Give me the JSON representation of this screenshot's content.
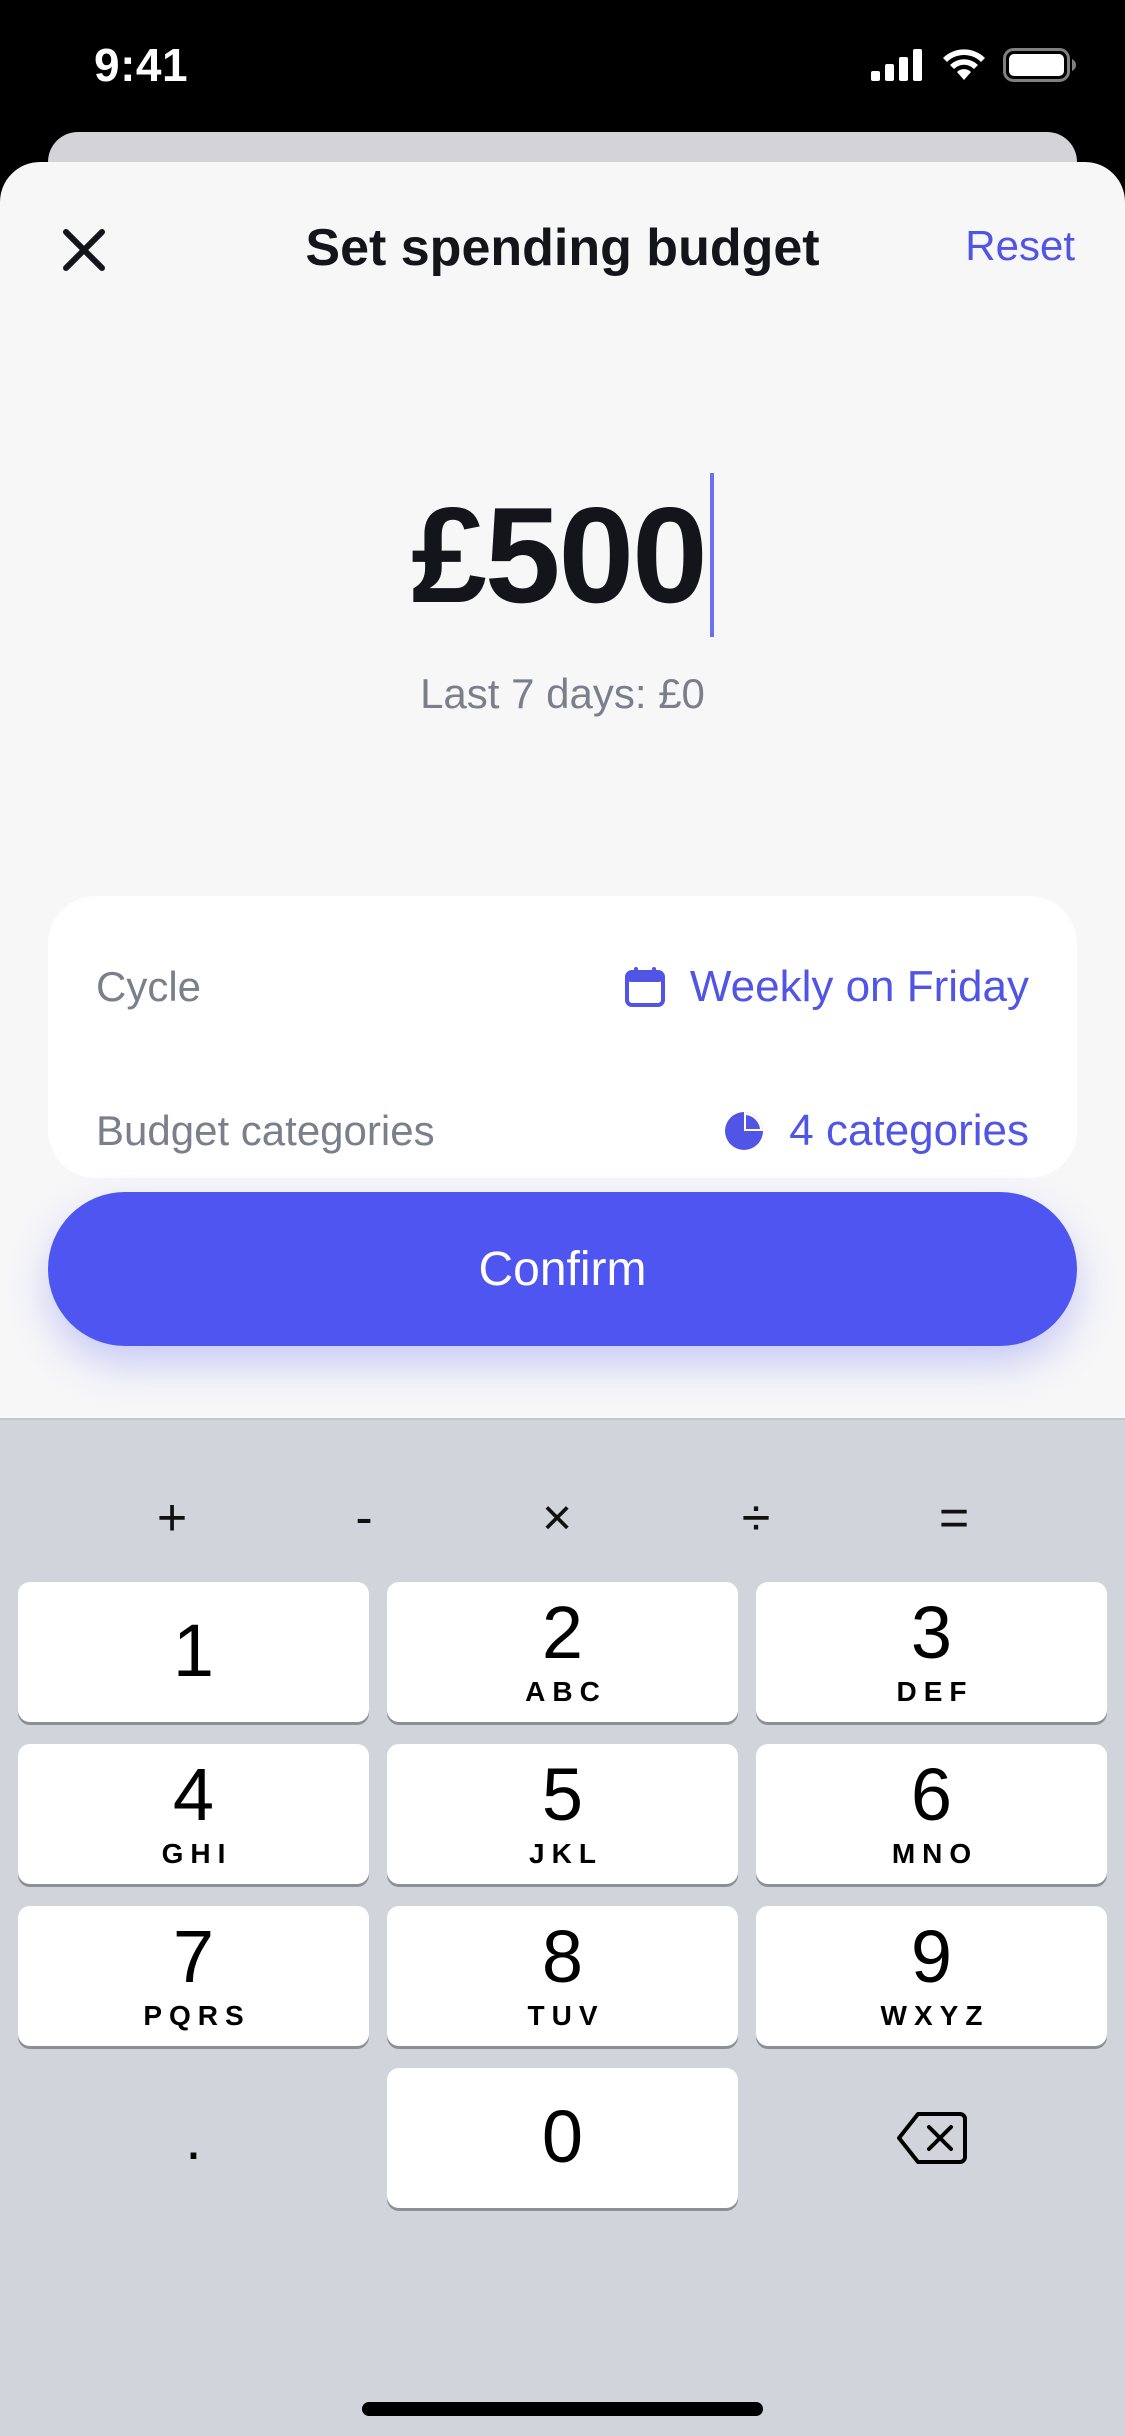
{
  "status_bar": {
    "time": "9:41"
  },
  "header": {
    "title": "Set spending budget",
    "reset_label": "Reset"
  },
  "amount": {
    "value": "£500",
    "last_period": "Last 7 days: £0"
  },
  "settings": {
    "cycle_label": "Cycle",
    "cycle_value": "Weekly on Friday",
    "categories_label": "Budget categories",
    "categories_value": "4 categories"
  },
  "confirm_label": "Confirm",
  "keyboard": {
    "operators": [
      "+",
      "-",
      "×",
      "÷",
      "="
    ],
    "keys": [
      {
        "num": "1",
        "letters": ""
      },
      {
        "num": "2",
        "letters": "ABC"
      },
      {
        "num": "3",
        "letters": "DEF"
      },
      {
        "num": "4",
        "letters": "GHI"
      },
      {
        "num": "5",
        "letters": "JKL"
      },
      {
        "num": "6",
        "letters": "MNO"
      },
      {
        "num": "7",
        "letters": "PQRS"
      },
      {
        "num": "8",
        "letters": "TUV"
      },
      {
        "num": "9",
        "letters": "WXYZ"
      },
      {
        "num": "0",
        "letters": ""
      }
    ],
    "decimal": "."
  },
  "colors": {
    "accent": "#4f55f0",
    "link": "#5055e6",
    "secondary_text": "#7b7f8c",
    "sheet_bg": "#f7f7f8",
    "keyboard_bg": "#d1d4db"
  },
  "icons": {
    "close": "close-icon",
    "calendar": "calendar-icon",
    "pie": "pie-chart-icon",
    "backspace": "backspace-icon"
  }
}
